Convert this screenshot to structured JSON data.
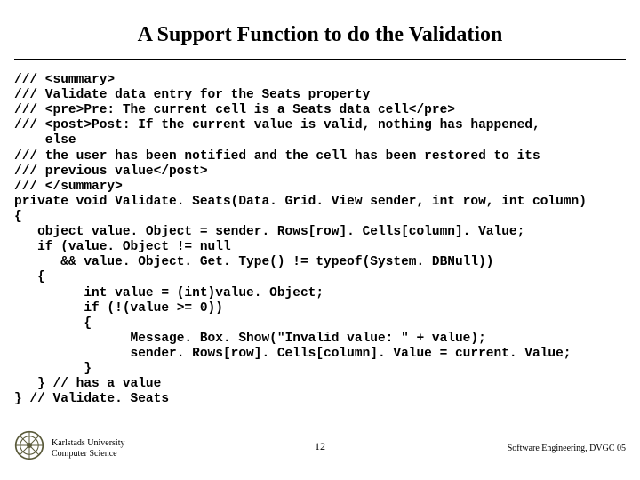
{
  "title": "A Support Function to do the Validation",
  "code_lines": [
    "/// <summary>",
    "/// Validate data entry for the Seats property",
    "/// <pre>Pre: The current cell is a Seats data cell</pre>",
    "/// <post>Post: If the current value is valid, nothing has happened,",
    "    else",
    "/// the user has been notified and the cell has been restored to its",
    "/// previous value</post>",
    "/// </summary>",
    "private void Validate. Seats(Data. Grid. View sender, int row, int column)",
    "{",
    "   object value. Object = sender. Rows[row]. Cells[column]. Value;",
    "   if (value. Object != null",
    "      && value. Object. Get. Type() != typeof(System. DBNull))",
    "   {",
    "         int value = (int)value. Object;",
    "         if (!(value >= 0))",
    "         {",
    "               Message. Box. Show(\"Invalid value: \" + value);",
    "               sender. Rows[row]. Cells[column]. Value = current. Value;",
    "         }",
    "   } // has a value",
    "} // Validate. Seats"
  ],
  "footer": {
    "university_line1": "Karlstads University",
    "university_line2": "Computer Science",
    "page_number": "12",
    "course": "Software Engineering, DVGC 05"
  }
}
